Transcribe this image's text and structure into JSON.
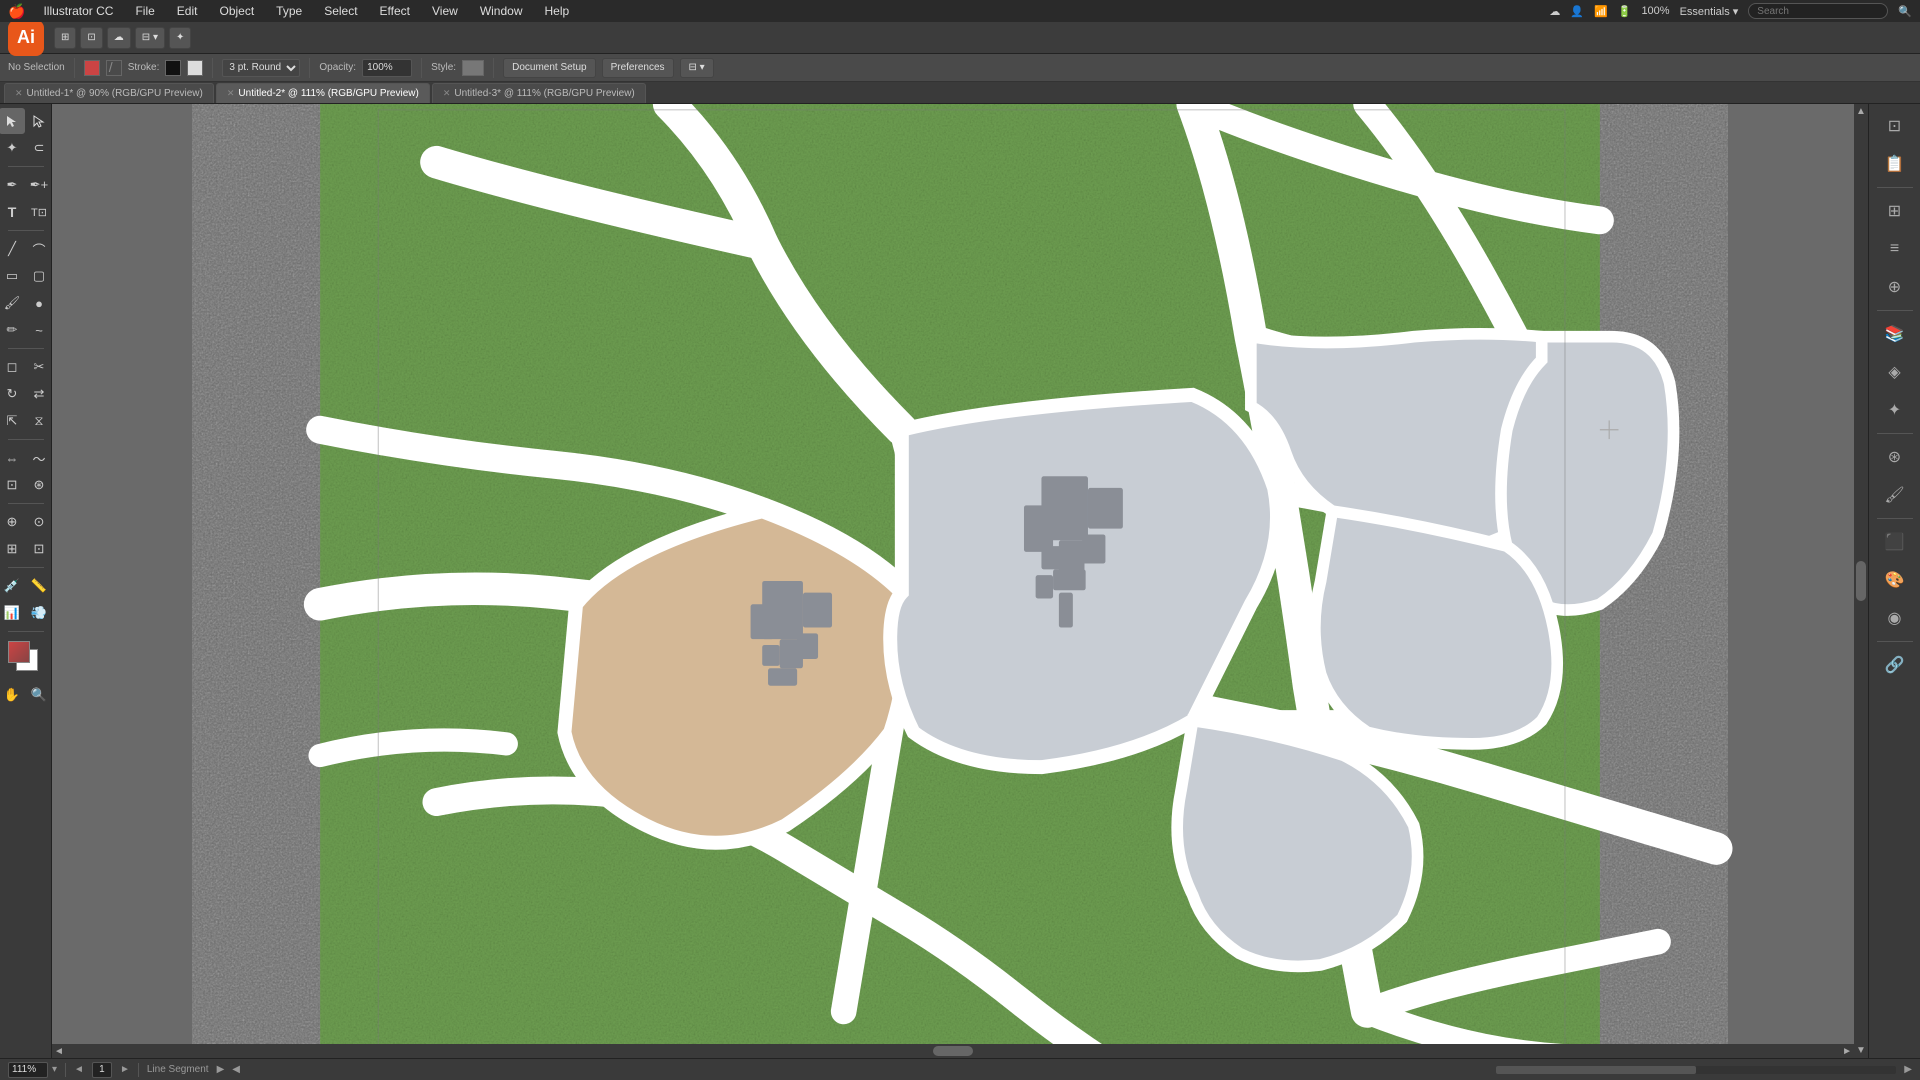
{
  "menubar": {
    "apple_icon": "🍎",
    "app_name": "Illustrator CC",
    "menus": [
      "File",
      "Edit",
      "Object",
      "Type",
      "Select",
      "Effect",
      "View",
      "Window",
      "Help"
    ],
    "right": {
      "essentials": "Essentials ▾",
      "search_placeholder": "Search"
    }
  },
  "toolbar": {
    "ai_label": "Ai",
    "buttons": [
      "⊞",
      "⊡",
      "✦",
      "⇄"
    ]
  },
  "options_bar": {
    "no_selection": "No Selection",
    "stroke_label": "Stroke:",
    "stroke_value": "",
    "weight_value": "3 pt. Round",
    "opacity_label": "Opacity:",
    "opacity_value": "100%",
    "style_label": "Style:",
    "doc_setup_label": "Document Setup",
    "preferences_label": "Preferences"
  },
  "tabs": [
    {
      "name": "Untitled-1*",
      "zoom": "90%",
      "mode": "RGB/GPU Preview",
      "active": false
    },
    {
      "name": "Untitled-2*",
      "zoom": "111%",
      "mode": "RGB/GPU Preview",
      "active": true
    },
    {
      "name": "Untitled-3*",
      "zoom": "111%",
      "mode": "RGB/GPU Preview",
      "active": false
    }
  ],
  "status_bar": {
    "zoom": "111%",
    "page": "1",
    "tool_name": "Line Segment"
  },
  "tools": {
    "groups": [
      [
        "selection",
        "direct-selection"
      ],
      [
        "magic-wand",
        "lasso"
      ],
      [
        "pen",
        "add-anchor"
      ],
      [
        "curvature",
        "anchor"
      ],
      [
        "type",
        "area-type"
      ],
      [
        "line-segment",
        "arc"
      ],
      [
        "rectangle",
        "rounded-rect"
      ],
      [
        "paintbrush",
        "blob-brush"
      ],
      [
        "pencil",
        "smooth"
      ],
      [
        "eraser",
        "scissors"
      ],
      [
        "rotate",
        "reflect"
      ],
      [
        "scale",
        "shear"
      ],
      [
        "width",
        "warp"
      ],
      [
        "free-transform",
        "puppet-warp"
      ],
      [
        "shape-builder",
        "live-paint"
      ],
      [
        "perspective-grid",
        "perspective-select"
      ],
      [
        "mesh",
        "gradient"
      ],
      [
        "eyedropper",
        "measure"
      ],
      [
        "blend",
        "symbol-sprayer"
      ],
      [
        "column-graph",
        "bar-graph"
      ],
      [
        "artboard",
        "slice"
      ],
      [
        "hand",
        "zoom"
      ]
    ],
    "color_fg": "#cc4444",
    "color_bg": "#ffffff"
  },
  "right_panel": {
    "buttons": [
      "layers",
      "artboards",
      "transform",
      "align",
      "pathfinder",
      "libraries",
      "appearance",
      "graphic-styles",
      "symbols",
      "brushes",
      "swatches",
      "color-guide",
      "color",
      "links"
    ]
  },
  "canvas": {
    "background_color": "#6b6b6b",
    "artboard_bg": "#6fa052"
  }
}
